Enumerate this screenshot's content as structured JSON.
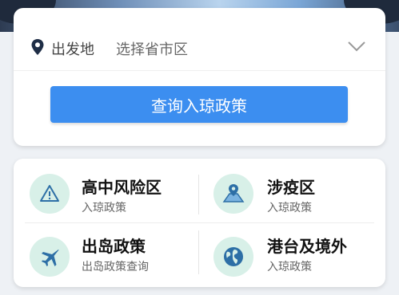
{
  "origin": {
    "label": "出发地",
    "placeholder": "选择省市区"
  },
  "query_button": "查询入琼政策",
  "tiles": [
    {
      "title": "高中风险区",
      "subtitle": "入琼政策",
      "icon": "warning-icon"
    },
    {
      "title": "涉疫区",
      "subtitle": "入琼政策",
      "icon": "map-pin-icon"
    },
    {
      "title": "出岛政策",
      "subtitle": "出岛政策查询",
      "icon": "airplane-icon"
    },
    {
      "title": "港台及境外",
      "subtitle": "入琼政策",
      "icon": "globe-icon"
    }
  ],
  "colors": {
    "primary": "#3c8ef0",
    "icon_bg": "#d8f0e8",
    "icon_fg": "#2d6fa6"
  }
}
